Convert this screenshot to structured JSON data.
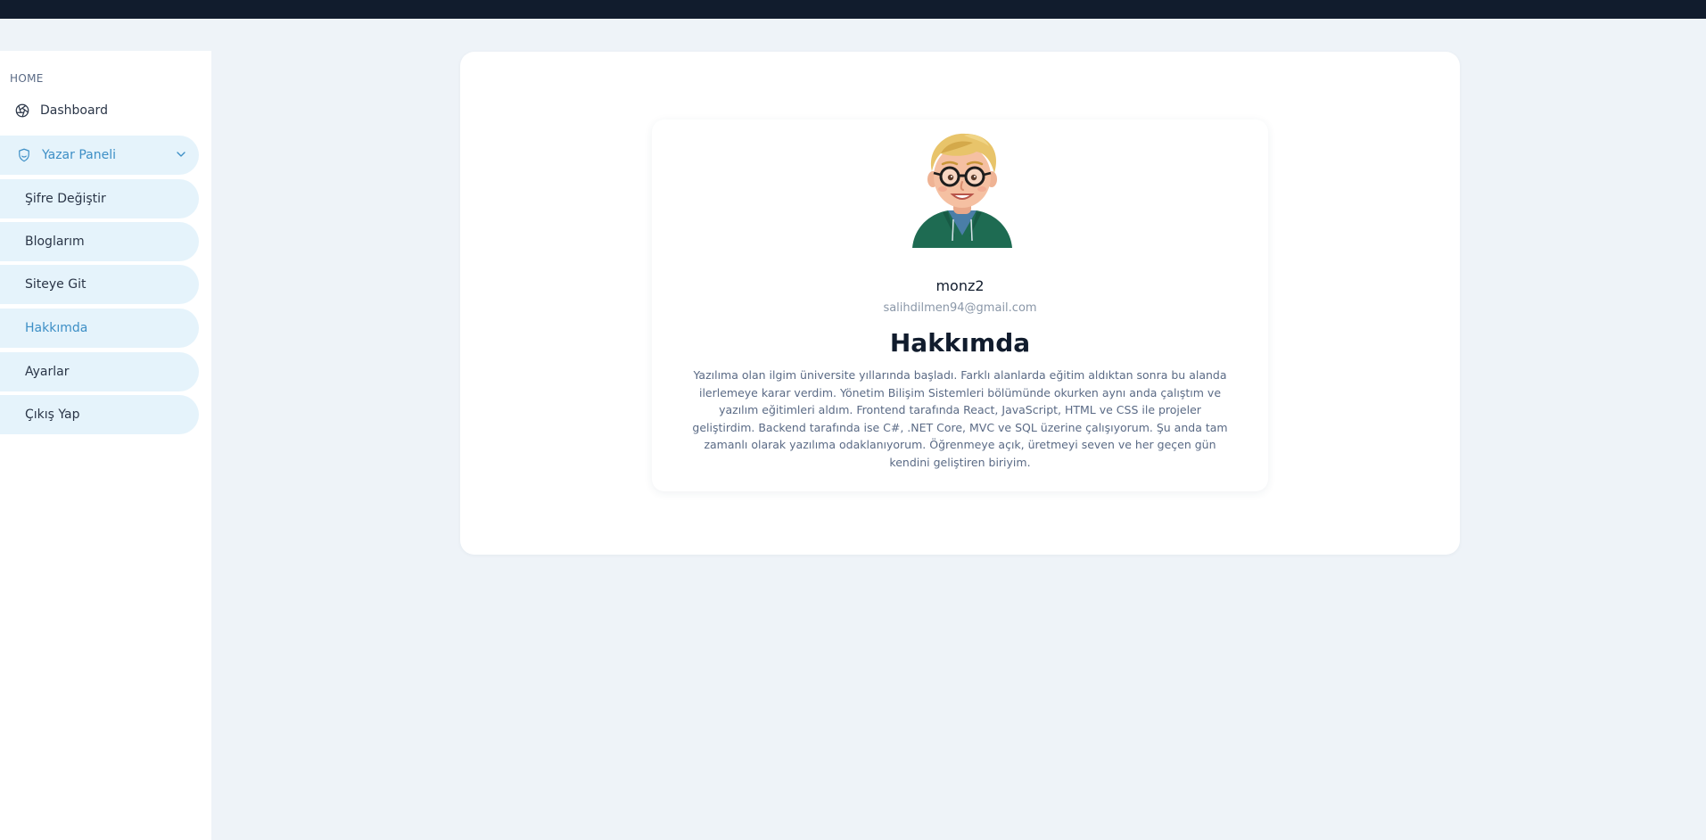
{
  "sidebar": {
    "section_caption": "HOME",
    "items": [
      {
        "label": "Dashboard",
        "icon": "aperture-icon"
      },
      {
        "label": "Yazar Paneli",
        "icon": "user-shield-icon"
      },
      {
        "label": "Şifre Değiştir"
      },
      {
        "label": "Bloglarım"
      },
      {
        "label": "Siteye Git"
      },
      {
        "label": "Hakkımda"
      },
      {
        "label": "Ayarlar"
      },
      {
        "label": "Çıkış Yap"
      }
    ]
  },
  "profile": {
    "username": "monz2",
    "email": "salihdilmen94@gmail.com",
    "heading": "Hakkımda",
    "bio": "Yazılıma olan ilgim üniversite yıllarında başladı. Farklı alanlarda eğitim aldıktan sonra bu alanda ilerlemeye karar verdim. Yönetim Bilişim Sistemleri bölümünde okurken aynı anda çalıştım ve yazılım eğitimleri aldım. Frontend tarafında React, JavaScript, HTML ve CSS ile projeler geliştirdim. Backend tarafında ise C#, .NET Core, MVC ve SQL üzerine çalışıyorum. Şu anda tam zamanlı olarak yazılıma odaklanıyorum. Öğrenmeye açık, üretmeyi seven ve her geçen gün kendini geliştiren biriyim."
  },
  "colors": {
    "accent": "#3d8fc6",
    "topbar": "#111c2d",
    "page_bg": "#eef3f8",
    "submenu_bg": "#e5f3fb"
  }
}
